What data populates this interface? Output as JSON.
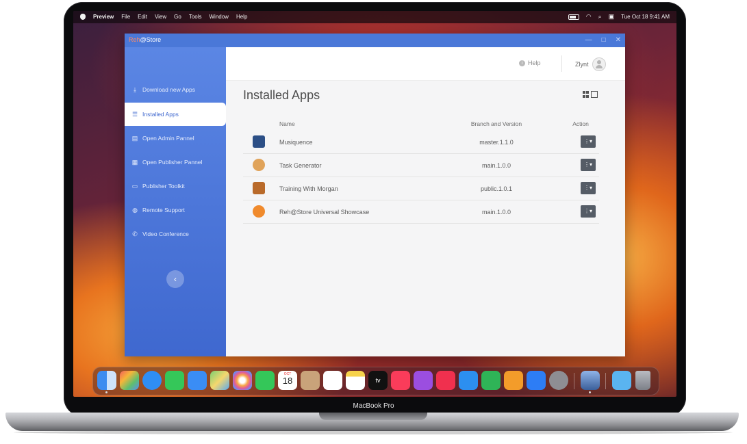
{
  "menubar": {
    "app": "Preview",
    "menus": [
      "File",
      "Edit",
      "View",
      "Go",
      "Tools",
      "Window",
      "Help"
    ],
    "clock": "Tue Oct 18  9:41 AM"
  },
  "window": {
    "title_brand": "Reh",
    "title_rest": "@Store",
    "controls": [
      "—",
      "□",
      "✕"
    ]
  },
  "sidebar": {
    "items": [
      {
        "label": "Download new Apps",
        "icon": "⤓"
      },
      {
        "label": "Installed Apps",
        "icon": "☰"
      },
      {
        "label": "Open Admin Pannel",
        "icon": "▤"
      },
      {
        "label": "Open Publisher Pannel",
        "icon": "▦"
      },
      {
        "label": "Publisher Toolkit",
        "icon": "▭"
      },
      {
        "label": "Remote Support",
        "icon": "◍"
      },
      {
        "label": "Video Conference",
        "icon": "✆"
      }
    ],
    "collapse": "‹"
  },
  "topbar": {
    "help": "Help",
    "user": "Zlynt"
  },
  "page": {
    "title": "Installed Apps"
  },
  "table": {
    "headers": {
      "name": "Name",
      "branch": "Branch and Version",
      "action": "Action"
    },
    "rows": [
      {
        "name": "Musiquence",
        "branch": "master.1.1.0",
        "icon_color": "#2c4f86"
      },
      {
        "name": "Task Generator",
        "branch": "main.1.0.0",
        "icon_color": "#e0a35a"
      },
      {
        "name": "Training With Morgan",
        "branch": "public.1.0.1",
        "icon_color": "#b96a2a"
      },
      {
        "name": "Reh@Store Universal Showcase",
        "branch": "main.1.0.0",
        "icon_color": "#f08a2c"
      }
    ],
    "action_label": "⋮▾"
  },
  "dock": {
    "calendar_month": "OCT",
    "calendar_day": "18",
    "tv_label": "tv"
  },
  "laptop": {
    "model": "MacBook Pro"
  }
}
